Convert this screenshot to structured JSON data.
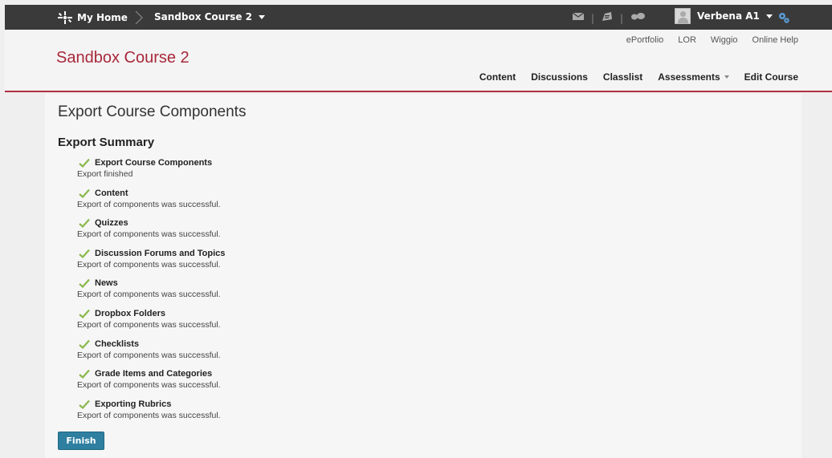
{
  "topbar": {
    "home_label": "My Home",
    "course_label": "Sandbox Course 2",
    "user_name": "Verbena A1"
  },
  "header": {
    "util_links": [
      "ePortfolio",
      "LOR",
      "Wiggio",
      "Online Help"
    ],
    "course_title": "Sandbox Course 2",
    "nav": {
      "content": "Content",
      "discussions": "Discussions",
      "classlist": "Classlist",
      "assessments": "Assessments",
      "edit_course": "Edit Course"
    }
  },
  "main": {
    "page_title": "Export Course Components",
    "summary_title": "Export Summary",
    "items": [
      {
        "title": "Export Course Components",
        "desc": "Export finished"
      },
      {
        "title": "Content",
        "desc": "Export of components was successful."
      },
      {
        "title": "Quizzes",
        "desc": "Export of components was successful."
      },
      {
        "title": "Discussion Forums and Topics",
        "desc": "Export of components was successful."
      },
      {
        "title": "News",
        "desc": "Export of components was successful."
      },
      {
        "title": "Dropbox Folders",
        "desc": "Export of components was successful."
      },
      {
        "title": "Checklists",
        "desc": "Export of components was successful."
      },
      {
        "title": "Grade Items and Categories",
        "desc": "Export of components was successful."
      },
      {
        "title": "Exporting Rubrics",
        "desc": "Export of components was successful."
      }
    ],
    "finish_label": "Finish"
  },
  "colors": {
    "topbar_bg": "#3a3a3a",
    "course_title": "#a8283a",
    "accent_line": "#b03040",
    "check": "#8ab84a",
    "finish_button": "#2e7fa0"
  },
  "icons": [
    "org-logo-icon",
    "chevron-right-icon",
    "caret-down-icon",
    "messages-icon",
    "updates-icon",
    "subscriptions-icon",
    "avatar",
    "settings-gear-icon",
    "checkmark-icon"
  ]
}
